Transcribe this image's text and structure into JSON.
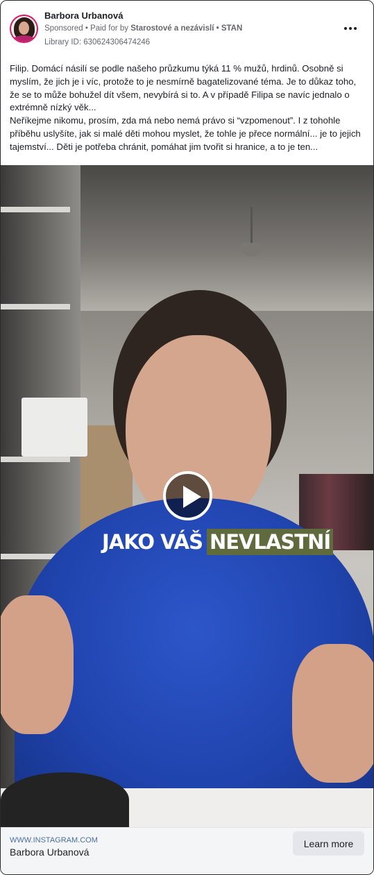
{
  "post": {
    "author": "Barbora Urbanová",
    "sponsored_label": "Sponsored",
    "paid_for_prefix": "Paid for by",
    "payer": "Starostové a nezávislí • STAN",
    "library_id": "Library ID: 630624306474246",
    "more_options_icon": "ellipsis-icon",
    "body_paragraphs": [
      "Filip. Domácí násilí se podle našeho průzkumu týká 11 % mužů, hrdinů. Osobně si myslím, že jich je i víc, protože to je nesmírně bagatelizované téma. Je to důkaz toho, že se to může bohužel dít všem, nevybírá si to. A v případě Filipa se navíc jednalo o extrémně nízký věk...",
      "Neříkejme nikomu, prosím, zda má nebo nemá právo si “vzpomenout”. I z tohohle příběhu uslyšíte, jak si malé děti mohou myslet, že tohle je přece normální... je to jejich tajemství... Děti je potřeba chránit, pomáhat jim tvořit si hranice, a to je ten..."
    ]
  },
  "video": {
    "caption_plain": "JAKO VÁŠ",
    "caption_highlight": "NEVLASTNÍ",
    "play_icon": "play-icon"
  },
  "footer": {
    "domain": "WWW.INSTAGRAM.COM",
    "title": "Barbora Urbanová",
    "cta_label": "Learn more"
  },
  "colors": {
    "avatar_ring": "#d7196e",
    "caption_highlight_bg": "#5f6b3c",
    "link_blue": "#4a6fa5"
  }
}
